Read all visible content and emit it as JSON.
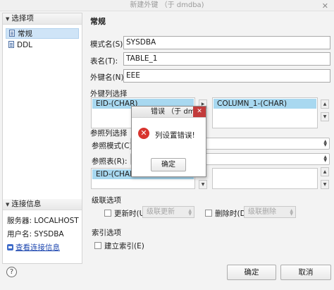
{
  "window": {
    "title": "新建外键 （于 dmdba)",
    "close_glyph": "✕"
  },
  "sidebar": {
    "section_label": "选择项",
    "items": [
      {
        "label": "常规",
        "icon": "document-icon"
      },
      {
        "label": "DDL",
        "icon": "document-icon"
      }
    ],
    "connection": {
      "section_label": "连接信息",
      "server": "服务器: LOCALHOST",
      "user": "用户名: SYSDBA",
      "view_link": "查看连接信息"
    }
  },
  "main": {
    "heading": "常规",
    "schema_label": "模式名(S):",
    "schema_value": "SYSDBA",
    "table_label": "表名(T):",
    "table_value": "TABLE_1",
    "fk_label": "外键名(N):",
    "fk_value": "EEE",
    "fk_columns_label": "外键列选择",
    "fk_columns_selected": "EID-(CHAR)",
    "fk_target_selected": "COLUMN_1-(CHAR)",
    "ref_columns_label": "参照列选择",
    "ref_schema_label": "参照模式(C):",
    "ref_table_label": "参照表(R):",
    "ref_columns_selected": "EID-(CHAR",
    "cascade_label": "级联选项",
    "on_update_label": "更新时(U):",
    "on_update_value": "级联更新",
    "on_delete_label": "删除时(D):",
    "on_delete_value": "级联删除",
    "index_label": "索引选项",
    "create_index_label": "建立索引(E)"
  },
  "footer": {
    "help": "?",
    "ok": "确定",
    "cancel": "取消"
  },
  "dialog": {
    "title": "错误 （于 dm",
    "message": "列设置错误!",
    "ok": "确定",
    "close_glyph": "✕",
    "icon_glyph": "✕"
  },
  "colors": {
    "selection": "#a8d8f0",
    "error": "#d8352f",
    "link": "#1f48b0"
  }
}
